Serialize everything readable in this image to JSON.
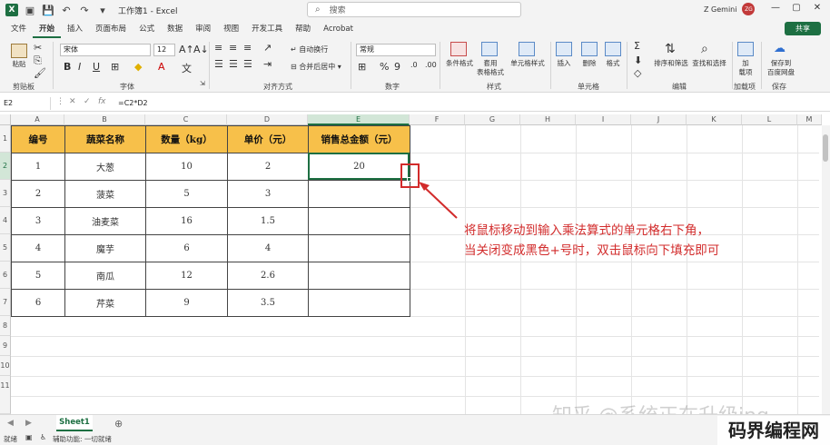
{
  "titlebar": {
    "app_icon": "X",
    "title": "工作簿1 - Excel",
    "search_placeholder": "搜索",
    "user_name": "Z Gemini",
    "avatar_initials": "ZG"
  },
  "tabs": [
    "文件",
    "开始",
    "插入",
    "页面布局",
    "公式",
    "数据",
    "审阅",
    "视图",
    "开发工具",
    "帮助",
    "Acrobat"
  ],
  "active_tab": "开始",
  "share_label": "共享",
  "ribbon": {
    "paste": "粘贴",
    "clipboard_label": "剪贴板",
    "font_name": "宋体",
    "font_size": "12",
    "font_label": "字体",
    "wrap_text": "自动换行",
    "merge_center": "合并后居中",
    "alignment_label": "对齐方式",
    "number_format": "常规",
    "number_label": "数字",
    "cond_format": "条件格式",
    "table_format": "套用\n表格格式",
    "cell_style": "单元格样式",
    "styles_label": "样式",
    "insert": "插入",
    "delete": "删除",
    "format": "格式",
    "cells_label": "单元格",
    "sort_filter": "排序和筛选",
    "find_select": "查找和选择",
    "editing_label": "编辑",
    "addins": "加\n载项",
    "addins_label": "加载项",
    "save_baidu": "保存到\n百度网盘",
    "save_label": "保存"
  },
  "formula_bar": {
    "cell_ref": "E2",
    "formula": "=C2*D2"
  },
  "columns": [
    "A",
    "B",
    "C",
    "D",
    "E",
    "F",
    "G",
    "H",
    "I",
    "J",
    "K",
    "L",
    "M"
  ],
  "rows": [
    "1",
    "2",
    "3",
    "4",
    "5",
    "6",
    "7",
    "8",
    "9",
    "10",
    "11"
  ],
  "table": {
    "headers": [
      "编号",
      "蔬菜名称",
      "数量（kg）",
      "单价（元）",
      "销售总金额（元）"
    ],
    "rows": [
      [
        "1",
        "大葱",
        "10",
        "2",
        "20"
      ],
      [
        "2",
        "菠菜",
        "5",
        "3",
        ""
      ],
      [
        "3",
        "油麦菜",
        "16",
        "1.5",
        ""
      ],
      [
        "4",
        "魔芋",
        "6",
        "4",
        ""
      ],
      [
        "5",
        "南瓜",
        "12",
        "2.6",
        ""
      ],
      [
        "6",
        "芹菜",
        "9",
        "3.5",
        ""
      ]
    ]
  },
  "annotation": {
    "line1": "将鼠标移动到输入乘法算式的单元格右下角，",
    "line2": "当关闭变成黑色+号时，双击鼠标向下填充即可"
  },
  "sheet_tab": "Sheet1",
  "status": {
    "ready": "就绪",
    "accessibility": "辅助功能: 一切就绪"
  },
  "watermarks": {
    "zhihu": "知乎 @系统正在升级ing",
    "site": "码界编程网"
  },
  "colors": {
    "excel_green": "#1d6f42",
    "header_fill": "#f7c04a",
    "annotation_red": "#d22b2b"
  }
}
